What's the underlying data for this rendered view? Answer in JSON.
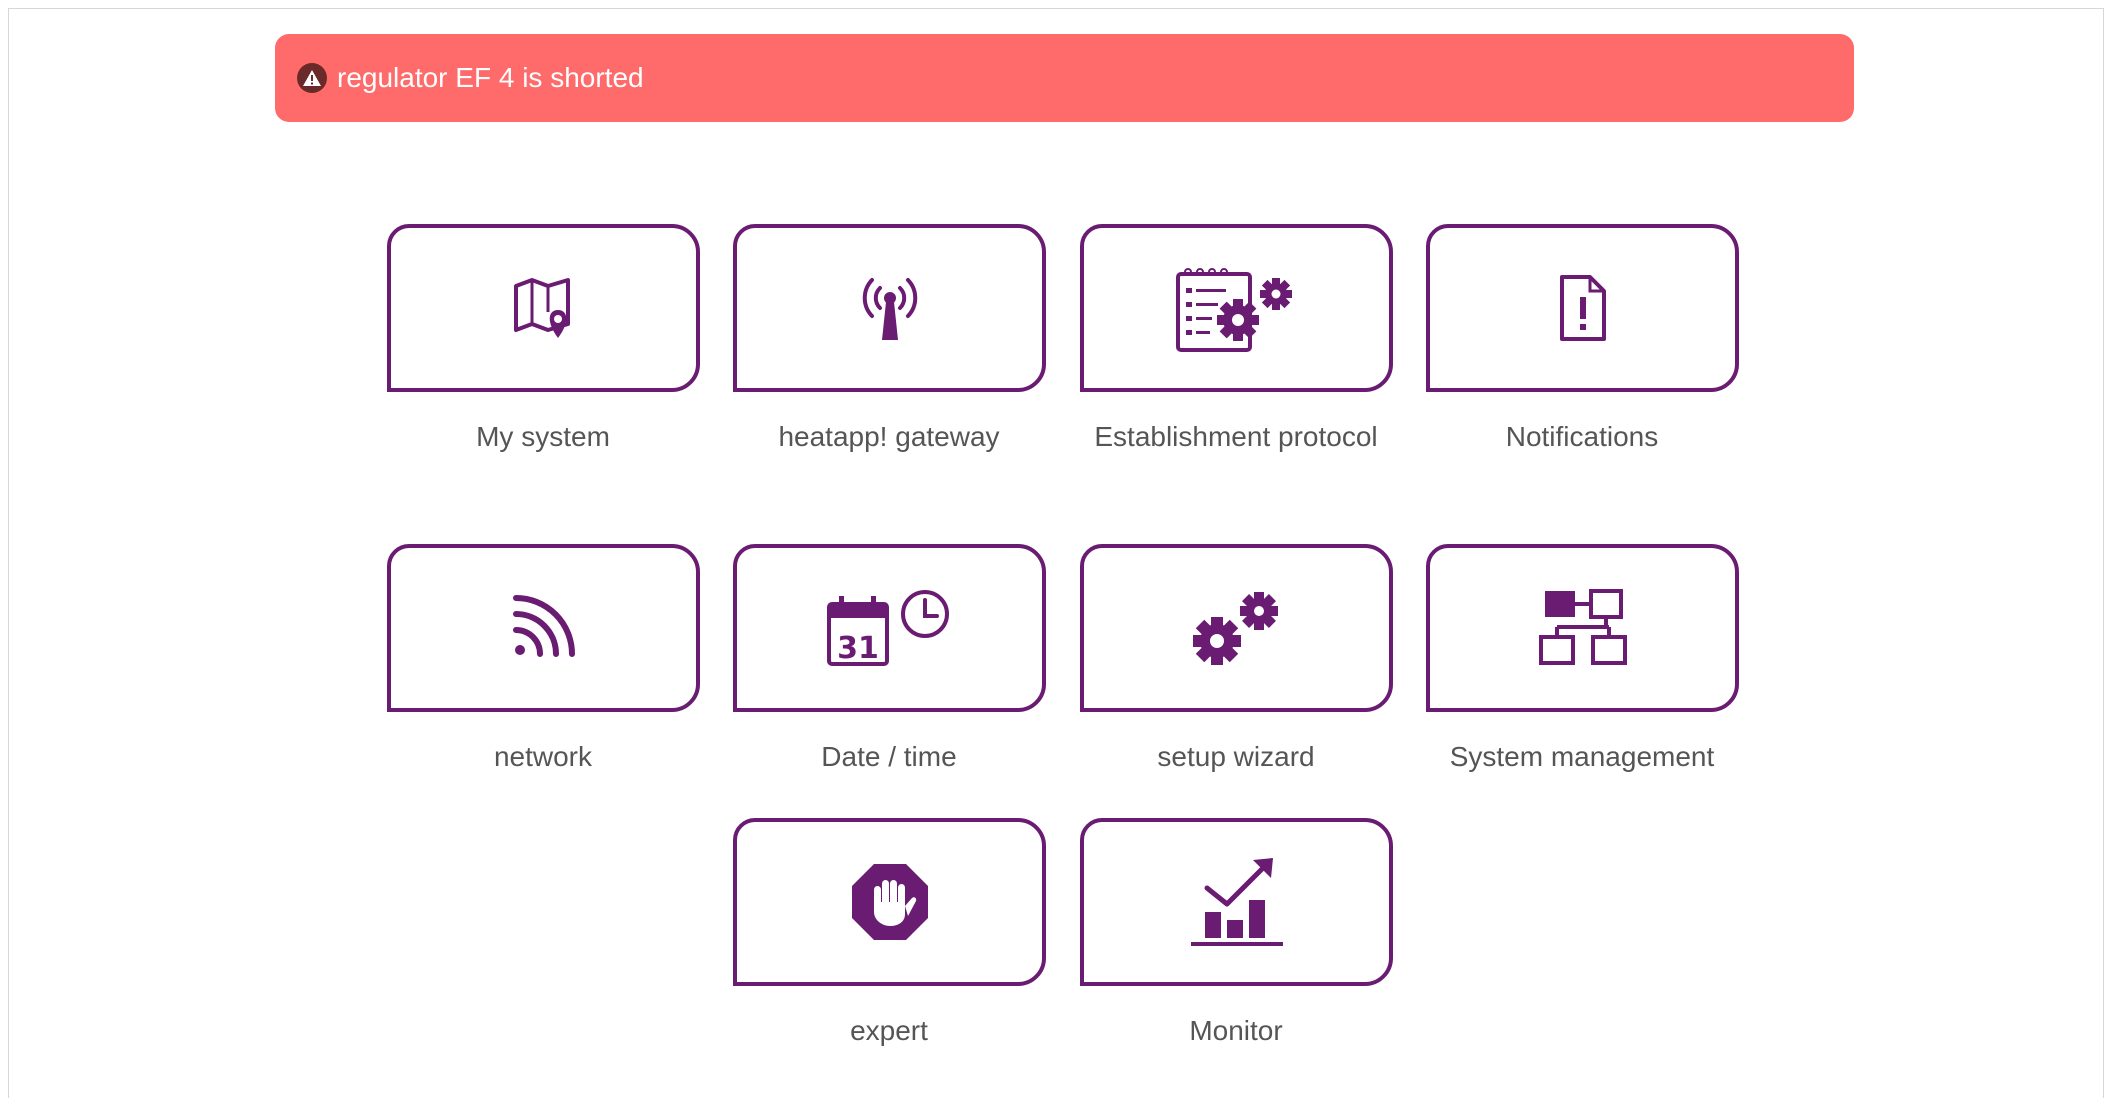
{
  "alert": {
    "text": "regulator EF 4 is shorted",
    "icon": "warning-icon",
    "color": "#ff6a6a"
  },
  "theme": {
    "tile_border": "#6a1b72",
    "icon_color": "#6a1b72",
    "label_color": "#555555"
  },
  "tiles": [
    {
      "label": "My system",
      "icon": "map-pin-icon"
    },
    {
      "label": "heatapp! gateway",
      "icon": "antenna-signal-icon"
    },
    {
      "label": "Establishment protocol",
      "icon": "protocol-gears-icon"
    },
    {
      "label": "Notifications",
      "icon": "notification-document-icon"
    },
    {
      "label": "network",
      "icon": "wireless-signal-icon"
    },
    {
      "label": "Date / time",
      "icon": "calendar-clock-icon"
    },
    {
      "label": "setup wizard",
      "icon": "gears-icon"
    },
    {
      "label": "System management",
      "icon": "network-hierarchy-icon"
    },
    {
      "label": "expert",
      "icon": "stop-hand-icon"
    },
    {
      "label": "Monitor",
      "icon": "chart-trend-icon"
    }
  ]
}
